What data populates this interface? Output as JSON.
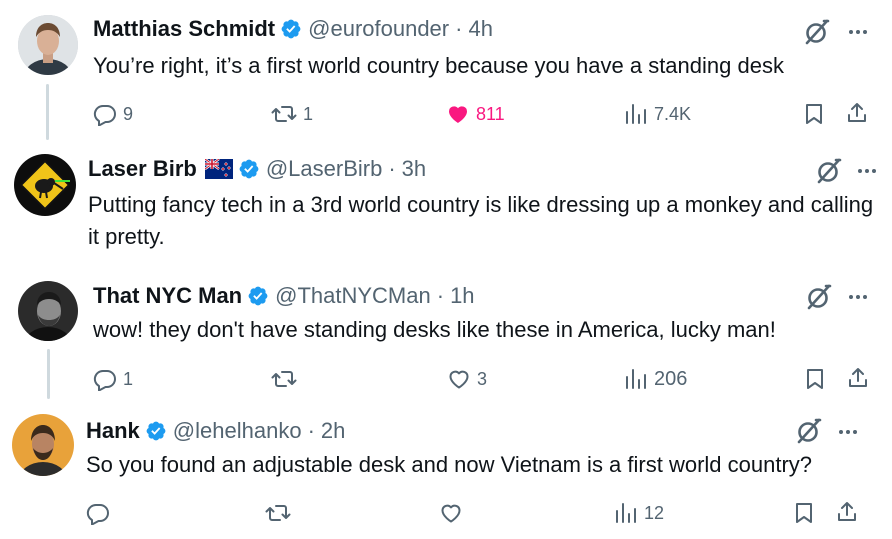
{
  "tweets": [
    {
      "name": "Matthias Schmidt",
      "handle": "@eurofounder",
      "separator": "·",
      "time": "4h",
      "text": "You’re right, it’s a first world country because you have a standing desk",
      "replies": "9",
      "retweets": "1",
      "likes": "811",
      "liked": true,
      "views": "7.4K"
    },
    {
      "name": "Laser Birb",
      "flag_icon": "new-zealand-flag-icon",
      "handle": "@LaserBirb",
      "separator": "·",
      "time": "3h",
      "text": "Putting fancy tech in a 3rd world country is like dressing up a monkey and calling it pretty."
    },
    {
      "name": "That NYC Man",
      "handle": "@ThatNYCMan",
      "separator": "·",
      "time": "1h",
      "text": "wow! they don't have standing desks like these in America, lucky man!",
      "replies": "1",
      "retweets": "",
      "likes": "3",
      "views": "206"
    },
    {
      "name": "Hank",
      "handle": "@lehelhanko",
      "separator": "·",
      "time": "2h",
      "text": "So you found an adjustable desk and now Vietnam is a first world country?",
      "replies": "",
      "retweets": "",
      "likes": "",
      "views": "12"
    }
  ],
  "colors": {
    "text": "#0f1419",
    "secondary": "#536471",
    "verified": "#1d9bf0",
    "like_active": "#f91880",
    "thread_line": "#cfd9de"
  }
}
